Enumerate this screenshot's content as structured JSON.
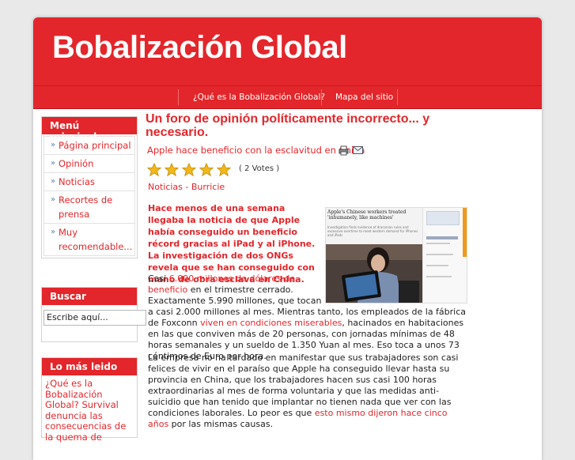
{
  "site": {
    "title": "Bobalización Global"
  },
  "nav": {
    "items": [
      "¿Qué es la Bobalización Global?",
      "Mapa del sitio"
    ]
  },
  "sidebar": {
    "menu_title": "Menú principal",
    "menu_items": [
      "Página principal",
      "Opinión",
      "Noticias",
      "Recortes de prensa",
      "Muy recomendable..."
    ],
    "search_title": "Buscar",
    "search_value": "Escribe aquí...",
    "latest_title": "Lo más leido",
    "latest_text": "¿Qué es la Bobalización Global? Survival denuncia las consecuencias de la quema de"
  },
  "content": {
    "title": "Un foro de opinión políticamente incorrecto... y necesario.",
    "subtitle": "Apple hace beneficio con la esclavitud en China",
    "rating": 5,
    "votes": "( 2 Votes )",
    "category": "Noticias - Burricie",
    "lead": "Hace menos de una semana llegaba la noticia de que Apple había conseguido un beneficio récord gracias al iPad y al iPhone. La investigación de dos ONGs revela que se han conseguido con mano de obra esclava en China.",
    "p1_a": "Casi ",
    "p1_link1": "6.000 millones de dólares de beneficio",
    "p1_b": " en el trimestre cerrado. Exactamente 5.990 millones, que tocan a casi 2.000 millones al mes. Mientras tanto, los empleados de la fábrica de Foxconn ",
    "p1_link2": "viven en condiciones miserables",
    "p1_c": ", hacinados en habitaciones en las que conviven más de 20 personas, con jornadas mínimas de 48 horas semanales y un sueldo de 1.350 Yuan al mes. Eso toca a unos 73 céntimos de Euro por hora.",
    "p2_a": "La empresa no ha tardado en manifestar que sus trabajadores son casi felices de vivir en el paraíso que Apple ha conseguido llevar hasta su provincia en China, que los trabajadores hacen sus casi 100 horas extraordinarias al mes de forma voluntaria y que las medidas anti-suicidio que han tenido que implantar no tienen nada que ver con las condiciones laborales. Lo peor es que ",
    "p2_link": "esto mismo dijeron hace cinco años",
    "p2_b": " por las mismas causas.",
    "photo_headline": "Apple's Chinese workers treated 'inhumanely, like machines'",
    "photo_caption": "Investigation finds evidence of draconian rules and excessive overtime to meet western demand for iPhones and iPads"
  },
  "colors": {
    "brand_red": "#e3262b",
    "link_red": "#e3262b"
  }
}
